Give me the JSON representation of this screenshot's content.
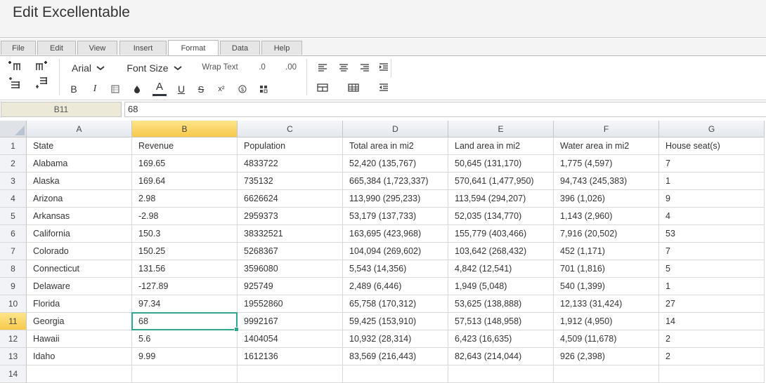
{
  "app": {
    "title": "Edit Excellentable"
  },
  "menu_tabs": [
    {
      "label": "File"
    },
    {
      "label": "Edit"
    },
    {
      "label": "View"
    },
    {
      "label": "Insert"
    },
    {
      "label": "Format",
      "active": true
    },
    {
      "label": "Data"
    },
    {
      "label": "Help"
    }
  ],
  "ribbon": {
    "font_family": "Arial",
    "font_size": "Font Size",
    "wrap_text": "Wrap Text",
    "decrease_decimal": ".0",
    "increase_decimal": ".00",
    "bold": "B",
    "italic": "I",
    "font_color_glyph": "A",
    "underline": "U",
    "strikethrough": "S",
    "superscript": "x²",
    "icons": [
      "insert-column-left-icon",
      "insert-column-right-icon",
      "insert-row-above-icon",
      "insert-row-below-icon",
      "cell-border-icon",
      "fill-color-icon",
      "currency-icon",
      "number-format-icon",
      "align-left-icon",
      "align-center-icon",
      "align-right-icon",
      "indent-icon",
      "merge-cells-icon",
      "table-icon",
      "outdent-icon"
    ],
    "colors": {
      "font_color_underline": "#2f3640"
    }
  },
  "formula_bar": {
    "cell_ref": "B11",
    "value": "68"
  },
  "sheet": {
    "columns": [
      "A",
      "B",
      "C",
      "D",
      "E",
      "F",
      "G"
    ],
    "selected_column": "B",
    "selected_row": "11",
    "rows": [
      {
        "num": "1",
        "cells": [
          "State",
          "Revenue",
          "Population",
          "Total area in mi2",
          "Land area in mi2",
          "Water area in mi2",
          "House seat(s)"
        ]
      },
      {
        "num": "2",
        "cells": [
          "Alabama",
          "169.65",
          "4833722",
          "52,420 (135,767)",
          "50,645 (131,170)",
          "1,775 (4,597)",
          "7"
        ]
      },
      {
        "num": "3",
        "cells": [
          "Alaska",
          "169.64",
          "735132",
          "665,384 (1,723,337)",
          "570,641 (1,477,950)",
          "94,743 (245,383)",
          "1"
        ]
      },
      {
        "num": "4",
        "cells": [
          "Arizona",
          "2.98",
          "6626624",
          "113,990 (295,233)",
          "113,594 (294,207)",
          "396 (1,026)",
          "9"
        ]
      },
      {
        "num": "5",
        "cells": [
          "Arkansas",
          "-2.98",
          "2959373",
          "53,179 (137,733)",
          "52,035 (134,770)",
          "1,143 (2,960)",
          "4"
        ]
      },
      {
        "num": "6",
        "cells": [
          "California",
          "150.3",
          "38332521",
          "163,695 (423,968)",
          "155,779 (403,466)",
          "7,916 (20,502)",
          "53"
        ]
      },
      {
        "num": "7",
        "cells": [
          "Colorado",
          "150.25",
          "5268367",
          "104,094 (269,602)",
          "103,642 (268,432)",
          "452 (1,171)",
          "7"
        ]
      },
      {
        "num": "8",
        "cells": [
          "Connecticut",
          "131.56",
          "3596080",
          "5,543 (14,356)",
          "4,842 (12,541)",
          "701 (1,816)",
          "5"
        ]
      },
      {
        "num": "9",
        "cells": [
          "Delaware",
          "-127.89",
          "925749",
          "2,489 (6,446)",
          "1,949 (5,048)",
          "540 (1,399)",
          "1"
        ]
      },
      {
        "num": "10",
        "cells": [
          "Florida",
          "97.34",
          "19552860",
          "65,758 (170,312)",
          "53,625 (138,888)",
          "12,133 (31,424)",
          "27"
        ]
      },
      {
        "num": "11",
        "cells": [
          "Georgia",
          "68",
          "9992167",
          "59,425 (153,910)",
          "57,513 (148,958)",
          "1,912 (4,950)",
          "14"
        ]
      },
      {
        "num": "12",
        "cells": [
          "Hawaii",
          "5.6",
          "1404054",
          "10,932 (28,314)",
          "6,423 (16,635)",
          "4,509 (11,678)",
          "2"
        ]
      },
      {
        "num": "13",
        "cells": [
          "Idaho",
          "9.99",
          "1612136",
          "83,569 (216,443)",
          "82,643 (214,044)",
          "926 (2,398)",
          "2"
        ]
      },
      {
        "num": "14",
        "cells": [
          "",
          "",
          "",
          "",
          "",
          "",
          ""
        ]
      }
    ]
  }
}
